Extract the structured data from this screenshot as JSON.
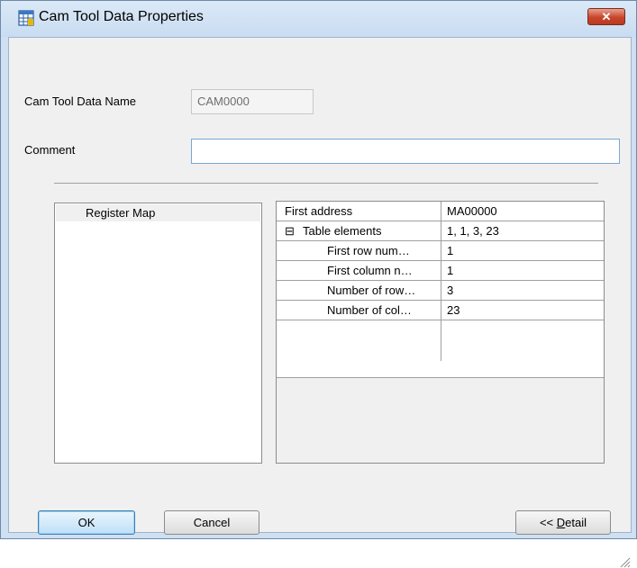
{
  "window": {
    "title": "Cam Tool Data Properties",
    "close_label": "✕"
  },
  "form": {
    "name_label": "Cam Tool Data Name",
    "name_value": "CAM0000",
    "comment_label": "Comment",
    "comment_value": ""
  },
  "register_map": {
    "items": [
      {
        "label": "Register Map",
        "selected": true
      }
    ]
  },
  "property_grid": {
    "rows": [
      {
        "name": "First address",
        "value": "MA00000",
        "indent": 0,
        "expander": ""
      },
      {
        "name": "Table elements",
        "value": "1, 1, 3, 23",
        "indent": 0,
        "expander": "⊟"
      },
      {
        "name": "First row num…",
        "value": "1",
        "indent": 1,
        "expander": ""
      },
      {
        "name": "First column n…",
        "value": "1",
        "indent": 1,
        "expander": ""
      },
      {
        "name": "Number of row…",
        "value": "3",
        "indent": 1,
        "expander": ""
      },
      {
        "name": "Number of col…",
        "value": "23",
        "indent": 1,
        "expander": ""
      }
    ],
    "description": ""
  },
  "buttons": {
    "ok": "OK",
    "cancel": "Cancel",
    "detail_prefix": "<< ",
    "detail_mnemonic": "D",
    "detail_rest": "etail"
  },
  "colors": {
    "title_bar": "#cfe0f2",
    "close_button": "#c8452b",
    "focus_border": "#3c7fb1"
  },
  "icons": {
    "app": "grid-table-icon",
    "close": "close-icon",
    "collapse": "minus-box-icon",
    "resize": "resize-grip-icon"
  }
}
